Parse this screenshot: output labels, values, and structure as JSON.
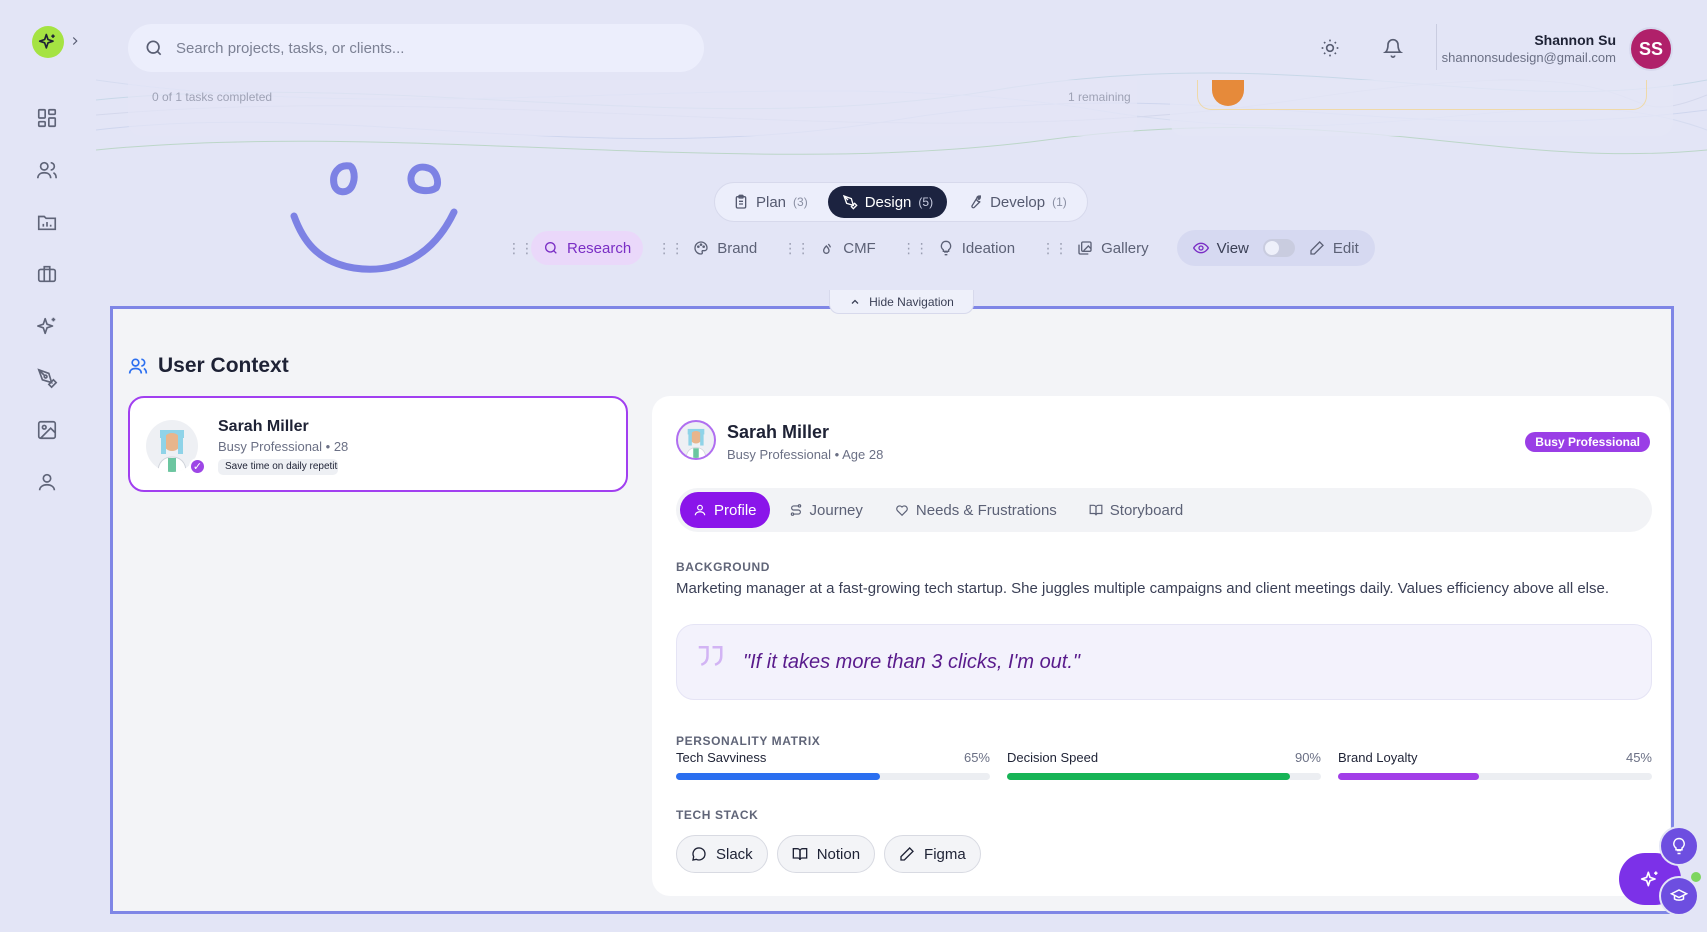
{
  "search": {
    "placeholder": "Search projects, tasks, or clients..."
  },
  "user": {
    "name": "Shannon Su",
    "email": "shannonsudesign@gmail.com",
    "initials": "SS"
  },
  "faded": {
    "left": "0 of 1 tasks completed",
    "right": "1 remaining"
  },
  "phases": [
    {
      "label": "Plan",
      "count": "(3)"
    },
    {
      "label": "Design",
      "count": "(5)"
    },
    {
      "label": "Develop",
      "count": "(1)"
    }
  ],
  "subtabs": [
    "Research",
    "Brand",
    "CMF",
    "Ideation",
    "Gallery"
  ],
  "mode": {
    "view": "View",
    "edit": "Edit"
  },
  "hide_nav": "Hide Navigation",
  "section": {
    "title": "User Context"
  },
  "persona": {
    "name": "Sarah Miller",
    "sub": "Busy Professional • 28",
    "tag": "Save time on daily repetitive tasks"
  },
  "detail": {
    "name": "Sarah Miller",
    "sub": "Busy Professional • Age 28",
    "badge": "Busy Professional",
    "tabs": [
      "Profile",
      "Journey",
      "Needs & Frustrations",
      "Storyboard"
    ],
    "background_label": "BACKGROUND",
    "background_text": "Marketing manager at a fast-growing tech startup. She juggles multiple campaigns and client meetings daily. Values efficiency above all else.",
    "quote": "\"If it takes more than 3 clicks, I'm out.\"",
    "matrix_label": "PERSONALITY MATRIX",
    "metrics": [
      {
        "name": "Tech Savviness",
        "pct": "65%",
        "value": 65,
        "color": "#2b6ff0"
      },
      {
        "name": "Decision Speed",
        "pct": "90%",
        "value": 90,
        "color": "#17b456"
      },
      {
        "name": "Brand Loyalty",
        "pct": "45%",
        "value": 45,
        "color": "#a23ee8"
      }
    ],
    "stack_label": "TECH STACK",
    "stack": [
      "Slack",
      "Notion",
      "Figma"
    ]
  },
  "colors": {
    "accent": "#8a15ea",
    "panel_border": "#7f86e6",
    "active_phase": "#1c2340"
  }
}
